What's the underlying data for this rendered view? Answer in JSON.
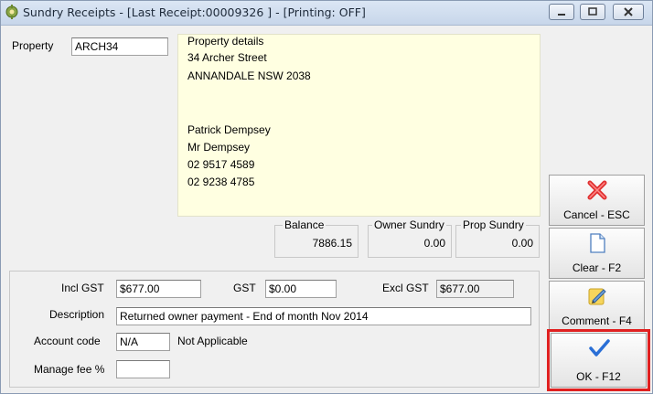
{
  "window": {
    "title": "Sundry Receipts - [Last Receipt:00009326 ] - [Printing: OFF]",
    "controls": [
      "minimize",
      "maximize",
      "close"
    ]
  },
  "property": {
    "label": "Property",
    "value": "ARCH34"
  },
  "property_details": {
    "legend": "Property details",
    "lines": [
      "34 Archer Street",
      "ANNANDALE  NSW  2038",
      "",
      "",
      "Patrick Dempsey",
      "Mr Dempsey",
      "02 9517 4589",
      "02 9238 4785"
    ]
  },
  "balances": [
    {
      "label": "Balance",
      "value": "7886.15"
    },
    {
      "label": "Owner Sundry",
      "value": "0.00"
    },
    {
      "label": "Prop Sundry",
      "value": "0.00"
    }
  ],
  "form": {
    "incl_gst_label": "Incl GST",
    "incl_gst_value": "$677.00",
    "gst_label": "GST",
    "gst_value": "$0.00",
    "excl_gst_label": "Excl GST",
    "excl_gst_value": "$677.00",
    "description_label": "Description",
    "description_value": "Returned owner payment - End of month Nov 2014",
    "account_code_label": "Account code",
    "account_code_value": "N/A",
    "account_code_desc": "Not Applicable",
    "manage_fee_label": "Manage fee %",
    "manage_fee_value": ""
  },
  "buttons": {
    "cancel": "Cancel - ESC",
    "clear": "Clear - F2",
    "comment": "Comment - F4",
    "ok": "OK - F12"
  },
  "colors": {
    "details_bg": "#ffffe1",
    "highlight": "#e02020",
    "cancel_icon": "#e03030",
    "ok_icon": "#2a6fd6"
  },
  "icons": {
    "cancel": "red-x-icon",
    "clear": "blank-page-icon",
    "comment": "pencil-note-icon",
    "ok": "blue-checkmark-icon"
  }
}
